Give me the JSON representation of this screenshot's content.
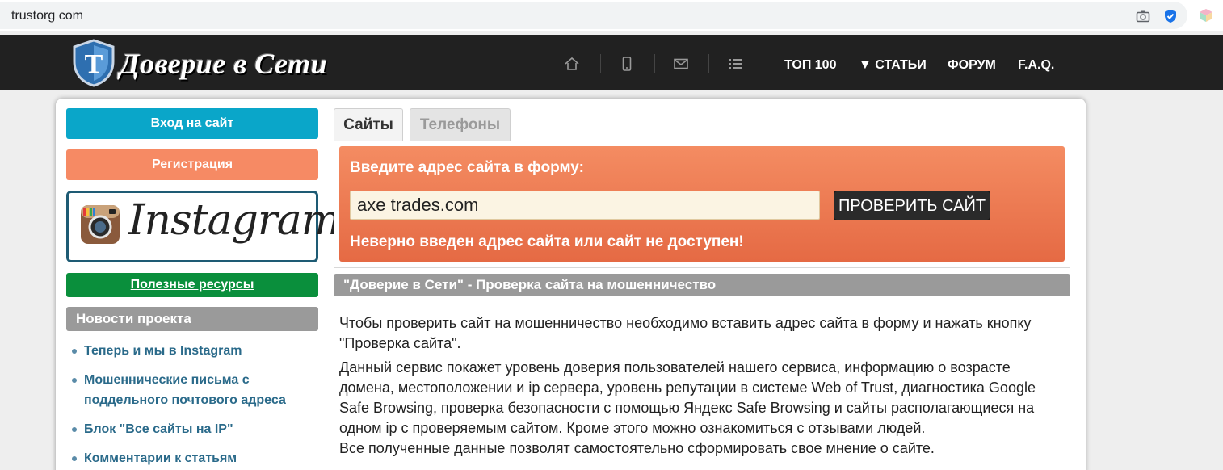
{
  "browser": {
    "url": "trustorg com"
  },
  "header": {
    "logo_text": "Доверие в Сети",
    "nav_icons": [
      "home-icon",
      "mobile-icon",
      "mail-icon",
      "list-icon"
    ],
    "nav_links": [
      "ТОП 100",
      "▼ СТАТЬИ",
      "ФОРУМ",
      "F.A.Q."
    ]
  },
  "sidebar": {
    "login_label": "Вход на сайт",
    "register_label": "Регистрация",
    "instagram_text": "Instagram",
    "useful_label": "Полезные ресурсы",
    "news_title": "Новости проекта",
    "news_items": [
      "Теперь и мы в Instagram",
      "Мошеннические письма с поддельного почтового адреса",
      "Блок \"Все сайты на IP\"",
      "Комментарии к статьям"
    ]
  },
  "tabs": [
    "Сайты",
    "Телефоны"
  ],
  "form": {
    "title": "Введите адрес сайта в форму:",
    "input_value": "axe trades.com",
    "button_label": "ПРОВЕРИТЬ САЙТ",
    "error_text": "Неверно введен адрес сайта или сайт не доступен!"
  },
  "content": {
    "section_title": "\"Доверие в Сети\" - Проверка сайта на мошенничество",
    "paragraph1": "Чтобы проверить сайт на мошенничество необходимо вставить адрес сайта в форму и нажать кнопку \"Проверка сайта\".",
    "paragraph2": "Данный сервис покажет уровень доверия пользователей нашего сервиса, информацию о возрасте домена, местоположении и ip сервера, уровень репутации в системе Web of Trust, диагностика Google Safe Browsing, проверка безопасности с помощью Яндекс Safe Browsing и сайты располагающиеся на одном ip с проверяемым сайтом. Кроме этого можно ознакомиться с отзывами людей.",
    "paragraph3": "Все полученные данные позволят самостоятельно сформировать свое мнение о сайте."
  },
  "colors": {
    "header_bg": "#212121",
    "login_btn": "#0aa6c9",
    "register_btn": "#f68a64",
    "useful_btn": "#0a8f3c",
    "form_bg": "#ec7a52",
    "grey_bar": "#9a9a9a"
  }
}
